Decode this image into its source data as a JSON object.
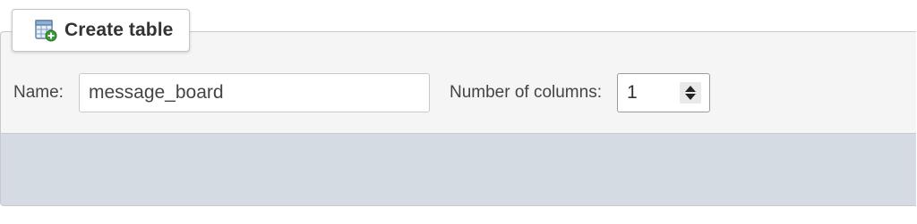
{
  "create_table": {
    "legend_label": "Create table",
    "legend_icon": "create-table-icon",
    "name_label": "Name:",
    "name_value": "message_board",
    "columns_label": "Number of columns:",
    "columns_value": "1",
    "columns_stepper_icon": "spinner-arrows-icon"
  },
  "colors": {
    "panel_bg": "#f5f5f5",
    "footer_bg": "#d4dbe2",
    "border": "#c9c9c9",
    "text": "#444444"
  }
}
